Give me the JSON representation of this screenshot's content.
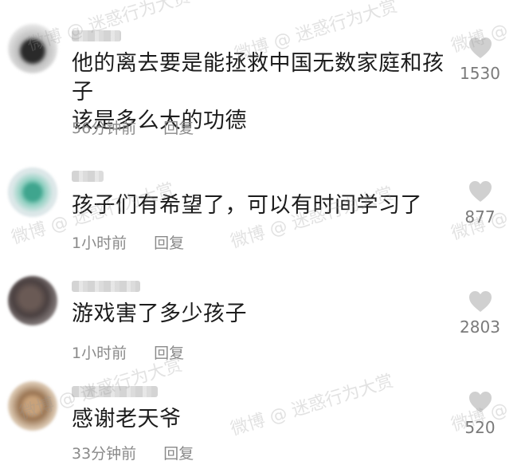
{
  "comments": [
    {
      "text_lines": [
        "他的离去要是能拯救中国无数家庭和孩子",
        "该是多么大的功德"
      ],
      "time": "56分钟前",
      "reply": "回复",
      "likes": "1530"
    },
    {
      "text_lines": [
        "孩子们有希望了，可以有时间学习了"
      ],
      "time": "1小时前",
      "reply": "回复",
      "likes": "877"
    },
    {
      "text_lines": [
        "游戏害了多少孩子"
      ],
      "time": "1小时前",
      "reply": "回复",
      "likes": "2803"
    },
    {
      "text_lines": [
        "感谢老天爷"
      ],
      "time": "33分钟前",
      "reply": "回复",
      "likes": "520"
    }
  ],
  "watermark": {
    "text": "微博 @ 迷惑行为大赏",
    "short": "微博 @"
  },
  "colors": {
    "text": "#1c1c1c",
    "meta": "#8a8a8a",
    "heart": "#d0d0d0"
  }
}
